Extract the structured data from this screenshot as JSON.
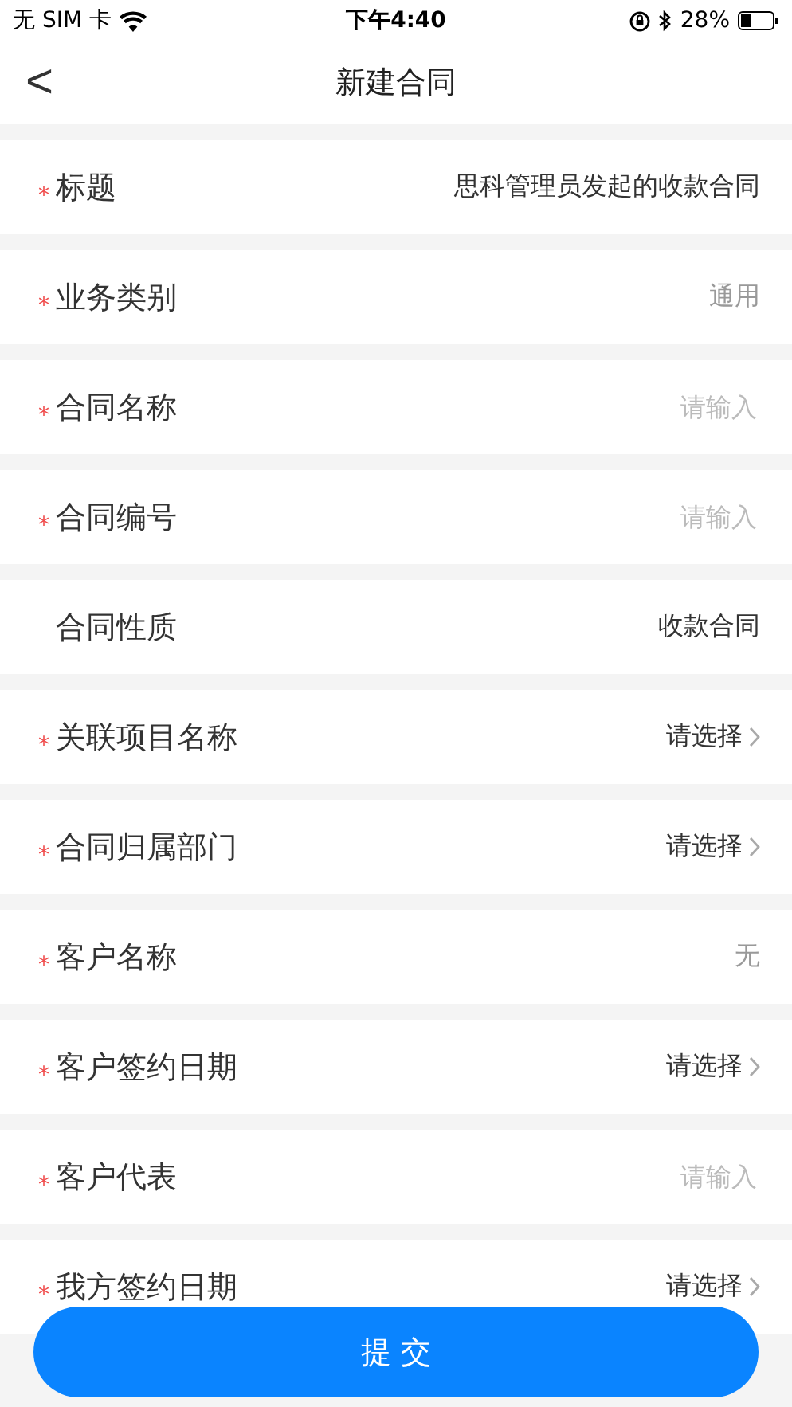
{
  "status_bar": {
    "carrier": "无 SIM 卡",
    "time": "下午4:40",
    "battery": "28%"
  },
  "nav": {
    "back": "<",
    "title": "新建合同"
  },
  "fields": [
    {
      "marker": "*",
      "label": "标题",
      "kind": "text",
      "value": "思科管理员发起的收款合同"
    },
    {
      "marker": "*",
      "label": "业务类别",
      "kind": "readonly",
      "value": "通用"
    },
    {
      "marker": "*",
      "label": "合同名称",
      "kind": "input",
      "placeholder": "请输入"
    },
    {
      "marker": "*",
      "label": "合同编号",
      "kind": "input",
      "placeholder": "请输入"
    },
    {
      "label": "合同性质",
      "kind": "text",
      "value": "收款合同"
    },
    {
      "marker": "*",
      "label": "关联项目名称",
      "kind": "select",
      "value": "请选择"
    },
    {
      "marker": "*",
      "label": "合同归属部门",
      "kind": "select",
      "value": "请选择"
    },
    {
      "marker": "*",
      "label": "客户名称",
      "kind": "readonly",
      "value": "无"
    },
    {
      "marker": "*",
      "label": "客户签约日期",
      "kind": "select",
      "value": "请选择"
    },
    {
      "marker": "*",
      "label": "客户代表",
      "kind": "input",
      "placeholder": "请输入"
    },
    {
      "marker": "*",
      "label": "我方签约日期",
      "kind": "select",
      "value": "请选择"
    }
  ],
  "submit": "提 交"
}
